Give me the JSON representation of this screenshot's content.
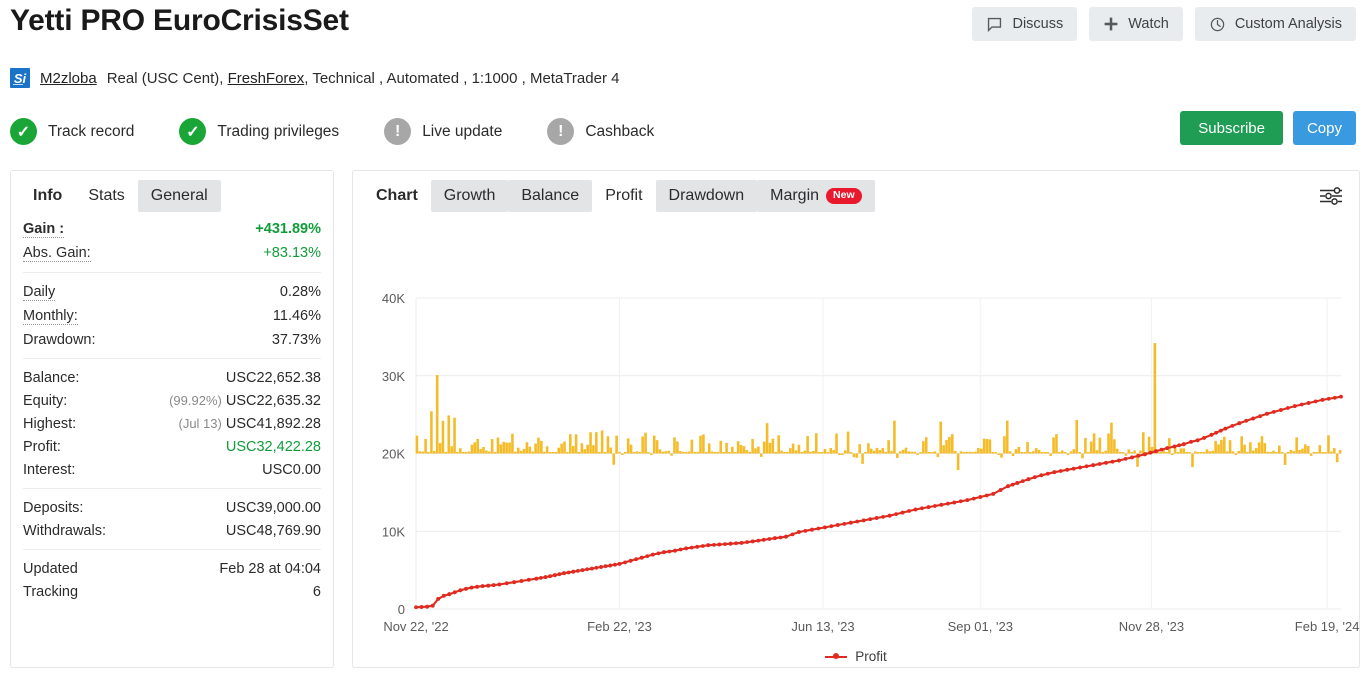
{
  "header": {
    "title": "Yetti PRO EuroCrisisSet",
    "buttons": [
      {
        "label": "Discuss",
        "icon": "comment-icon"
      },
      {
        "label": "Watch",
        "icon": "plus-icon"
      },
      {
        "label": "Custom Analysis",
        "icon": "clock-icon"
      }
    ]
  },
  "account": {
    "logo_text": "Si",
    "username": "M2zloba",
    "type": "Real (USC Cent),",
    "broker": "FreshForex",
    "details": ", Technical , Automated , 1:1000 , MetaTrader 4"
  },
  "status": [
    {
      "label": "Track record",
      "state": "ok",
      "glyph": "✓"
    },
    {
      "label": "Trading privileges",
      "state": "ok",
      "glyph": "✓"
    },
    {
      "label": "Live update",
      "state": "warn",
      "glyph": "!"
    },
    {
      "label": "Cashback",
      "state": "warn",
      "glyph": "!"
    }
  ],
  "cta": {
    "subscribe": "Subscribe",
    "copy": "Copy",
    "subscribe_color": "#1f9d55",
    "copy_color": "#3a9ae0"
  },
  "info_panel": {
    "tabs": [
      {
        "label": "Info",
        "active": true,
        "shaded": false
      },
      {
        "label": "Stats",
        "active": false,
        "shaded": false
      },
      {
        "label": "General",
        "active": false,
        "shaded": true
      }
    ],
    "groups": [
      {
        "rows": [
          {
            "key": "Gain :",
            "value": "+431.89%",
            "bold": true,
            "green": true,
            "underline": "dotted"
          },
          {
            "key": "Abs. Gain:",
            "value": "+83.13%",
            "bold": false,
            "green": true,
            "underline": "dotted"
          }
        ]
      },
      {
        "rows": [
          {
            "key": "Daily",
            "value": "0.28%",
            "bold": false,
            "green": false,
            "underline": "dotted"
          },
          {
            "key": "Monthly:",
            "value": "11.46%",
            "bold": false,
            "green": false,
            "underline": "dotted"
          },
          {
            "key": "Drawdown:",
            "value": "37.73%",
            "bold": false,
            "green": false,
            "underline": "none"
          }
        ]
      },
      {
        "rows": [
          {
            "key": "Balance:",
            "value": "USC22,652.38",
            "bold": false,
            "green": false,
            "underline": "none"
          },
          {
            "key": "Equity:",
            "value": "USC22,635.32",
            "prefix": "(99.92%)",
            "bold": false,
            "green": false,
            "underline": "none"
          },
          {
            "key": "Highest:",
            "value": "USC41,892.28",
            "prefix": "(Jul 13)",
            "bold": false,
            "green": false,
            "underline": "none"
          },
          {
            "key": "Profit:",
            "value": "USC32,422.28",
            "bold": false,
            "green": true,
            "underline": "none"
          },
          {
            "key": "Interest:",
            "value": "USC0.00",
            "bold": false,
            "green": false,
            "underline": "none"
          }
        ]
      },
      {
        "rows": [
          {
            "key": "Deposits:",
            "value": "USC39,000.00",
            "bold": false,
            "green": false,
            "underline": "none"
          },
          {
            "key": "Withdrawals:",
            "value": "USC48,769.90",
            "bold": false,
            "green": false,
            "underline": "none"
          }
        ]
      },
      {
        "rows": [
          {
            "key": "Updated",
            "value": "Feb 28 at 04:04",
            "bold": false,
            "green": false,
            "underline": "none"
          },
          {
            "key": "Tracking",
            "value": "6",
            "bold": false,
            "green": false,
            "underline": "none"
          }
        ]
      }
    ]
  },
  "chart_panel": {
    "tabs": [
      {
        "label": "Chart",
        "active": true,
        "shaded": false,
        "badge": ""
      },
      {
        "label": "Growth",
        "active": false,
        "shaded": true,
        "badge": ""
      },
      {
        "label": "Balance",
        "active": false,
        "shaded": true,
        "badge": ""
      },
      {
        "label": "Profit",
        "active": false,
        "shaded": false,
        "badge": ""
      },
      {
        "label": "Drawdown",
        "active": false,
        "shaded": true,
        "badge": ""
      },
      {
        "label": "Margin",
        "active": false,
        "shaded": true,
        "badge": "New"
      }
    ],
    "settings_icon": "sliders-icon"
  },
  "chart_data": {
    "type": "line",
    "title": "",
    "xlabel": "",
    "ylabel": "",
    "ylim": [
      0,
      40000
    ],
    "yticks": [
      0,
      10000,
      20000,
      30000,
      40000
    ],
    "ytick_labels": [
      "0",
      "10K",
      "20K",
      "30K",
      "40K"
    ],
    "grid": true,
    "legend": [
      {
        "name": "Profit",
        "color": "#e02b20",
        "marker": "line-dot"
      }
    ],
    "legend_position": "bottom-center",
    "xtick_labels": [
      "Nov 22, '22",
      "Feb 22, '23",
      "Jun 13, '23",
      "Sep 01, '23",
      "Nov 28, '23",
      "Feb 19, '24"
    ],
    "xtick_positions": [
      0.0,
      0.22,
      0.44,
      0.61,
      0.795,
      0.985
    ],
    "series": [
      {
        "name": "Profit",
        "type": "line",
        "color": "#e02b20",
        "x": [
          0.0,
          0.006,
          0.012,
          0.018,
          0.024,
          0.03,
          0.036,
          0.042,
          0.048,
          0.054,
          0.06,
          0.066,
          0.072,
          0.078,
          0.084,
          0.09,
          0.098,
          0.106,
          0.114,
          0.122,
          0.13,
          0.14,
          0.15,
          0.16,
          0.17,
          0.18,
          0.19,
          0.2,
          0.21,
          0.22,
          0.232,
          0.244,
          0.256,
          0.268,
          0.28,
          0.292,
          0.304,
          0.316,
          0.328,
          0.34,
          0.352,
          0.364,
          0.376,
          0.388,
          0.4,
          0.414,
          0.428,
          0.442,
          0.456,
          0.47,
          0.484,
          0.498,
          0.512,
          0.526,
          0.54,
          0.554,
          0.568,
          0.582,
          0.596,
          0.61,
          0.624,
          0.632,
          0.64,
          0.65,
          0.662,
          0.676,
          0.69,
          0.704,
          0.718,
          0.732,
          0.746,
          0.76,
          0.774,
          0.788,
          0.8,
          0.812,
          0.82,
          0.83,
          0.838,
          0.845,
          0.852,
          0.86,
          0.875,
          0.89,
          0.905,
          0.92,
          0.935,
          0.95,
          0.965,
          0.98,
          1.0
        ],
        "y": [
          220,
          260,
          300,
          420,
          1300,
          1700,
          1900,
          2150,
          2400,
          2600,
          2750,
          2850,
          2950,
          3000,
          3080,
          3150,
          3300,
          3450,
          3600,
          3750,
          3900,
          4100,
          4350,
          4600,
          4800,
          5000,
          5200,
          5400,
          5600,
          5800,
          6200,
          6600,
          7000,
          7300,
          7500,
          7800,
          8000,
          8200,
          8300,
          8400,
          8500,
          8700,
          8900,
          9100,
          9300,
          9900,
          10200,
          10500,
          10800,
          11100,
          11400,
          11700,
          12000,
          12400,
          12800,
          13100,
          13400,
          13700,
          14000,
          14400,
          14800,
          15300,
          15800,
          16200,
          16700,
          17200,
          17600,
          17900,
          18200,
          18500,
          18800,
          19100,
          19500,
          19900,
          20300,
          20700,
          20900,
          21200,
          21500,
          21700,
          22000,
          22400,
          23200,
          23900,
          24500,
          25100,
          25600,
          26100,
          26500,
          26900,
          27300
        ]
      },
      {
        "name": "Trades",
        "type": "bar",
        "color": "#f5bc2a",
        "baseline": 20000,
        "note": "Volatile per-trade bars centered on the 20K baseline; tallest bar near Nov '22 reaches ~30K and another near Jan '24 reaches ~34K"
      }
    ]
  }
}
